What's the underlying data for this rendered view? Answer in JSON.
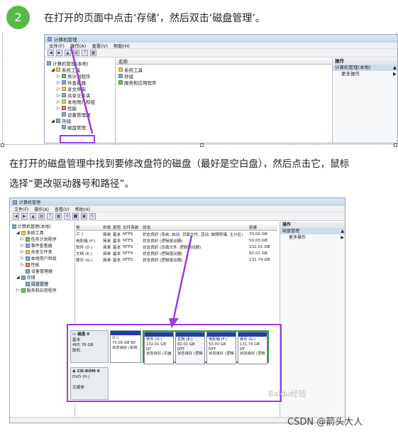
{
  "step": {
    "number": "2",
    "text": "在打开的页面中点击‘存储’，然后双击‘磁盘管理’。"
  },
  "paragraph": {
    "line1": "在打开的磁盘管理中找到要修改盘符的磁盘（最好是空白盘），然后点击它，鼠标",
    "line2": "选择“更改驱动器号和路径”。"
  },
  "screenshot1": {
    "title": "计算机管理",
    "menu": [
      "文件(F)",
      "操作(A)",
      "查看(V)",
      "帮助(H)"
    ],
    "tree_root": "计算机管理(本地)",
    "tree": [
      "系统工具",
      "任务计划程序",
      "事件查看器",
      "共享文件夹",
      "本地用户和组",
      "性能",
      "设备管理器",
      "存储",
      "磁盘管理",
      "服务和应用程序"
    ],
    "tree_partial": [
      "务计划程序",
      "件查看器",
      "享文件夹"
    ],
    "center_header": "名称",
    "center_items": [
      "系统工具",
      "存储",
      "服务和应用程序"
    ],
    "actions_header": "操作",
    "actions_selected": "计算机管理(本地)",
    "actions_more": "更多操作"
  },
  "screenshot2": {
    "title": "计算机管理",
    "menu": [
      "文件(F)",
      "操作(A)",
      "查看(V)",
      "帮助(H)"
    ],
    "tree_root": "计算机管理(本地)",
    "tree": [
      "系统工具",
      "任务计划程序",
      "事件查看器",
      "共享文件夹",
      "本地用户和组",
      "性能",
      "设备管理器",
      "存储",
      "磁盘管理",
      "服务和应用程序"
    ],
    "columns": [
      "卷",
      "布局",
      "类型",
      "文件系统",
      "状态",
      "容量"
    ],
    "volumes": [
      {
        "name": "(C:)",
        "layout": "简单",
        "type": "基本",
        "fs": "NTFS",
        "status": "状态良好 (系统, 启动, 页面文件, 活动, 故障转储, 主分区)",
        "cap": "70.00 GB"
      },
      {
        "name": "电影箱 (F:)",
        "layout": "简单",
        "type": "基本",
        "fs": "NTFS",
        "status": "状态良好 (逻辑驱动器)",
        "cap": "50.00 GB"
      },
      {
        "name": "软件 (D:)",
        "layout": "简单",
        "type": "基本",
        "fs": "NTFS",
        "status": "状态良好 (页面文件, 逻辑驱动器)",
        "cap": "132.01 GB"
      },
      {
        "name": "文档 (E:)",
        "layout": "简单",
        "type": "基本",
        "fs": "NTFS",
        "status": "状态良好 (逻辑驱动器)",
        "cap": "82.01 GB"
      },
      {
        "name": "娱乐 (G:)",
        "layout": "简单",
        "type": "基本",
        "fs": "NTFS",
        "status": "状态良好 (逻辑驱动器)",
        "cap": "131.74 GB"
      }
    ],
    "disk0": {
      "name": "磁盘 0",
      "kind": "基本",
      "size": "465.76 GB",
      "state": "联机"
    },
    "partitions": [
      {
        "label": "(C:)",
        "size": "70.00 GB NT",
        "status": "状态良好 (系统"
      },
      {
        "label": "软件 (D:)",
        "size": "132.01 GB NT",
        "status": "状态良好 (页面"
      },
      {
        "label": "文档 (E:)",
        "size": "82.01 GB NTF",
        "status": "状态良好 (逻辑"
      },
      {
        "label": "电影箱 (F:)",
        "size": "50.00 GB NTF",
        "status": "状态良好 (逻辑"
      },
      {
        "label": "娱乐 (G:)",
        "size": "131.74 GB NT",
        "status": "状态良好 (逻辑"
      }
    ],
    "cdrom": {
      "name": "CD-ROM 0",
      "kind": "DVD (H:)",
      "state": "无媒体"
    },
    "actions_header": "操作",
    "actions_selected": "磁盘管理",
    "actions_more": "更多操作"
  },
  "watermark": "Baidu经验",
  "credit": "CSDN @箭头大人",
  "colors": {
    "accent_purple": "#9b3be0",
    "badge_green": "#58b947"
  }
}
